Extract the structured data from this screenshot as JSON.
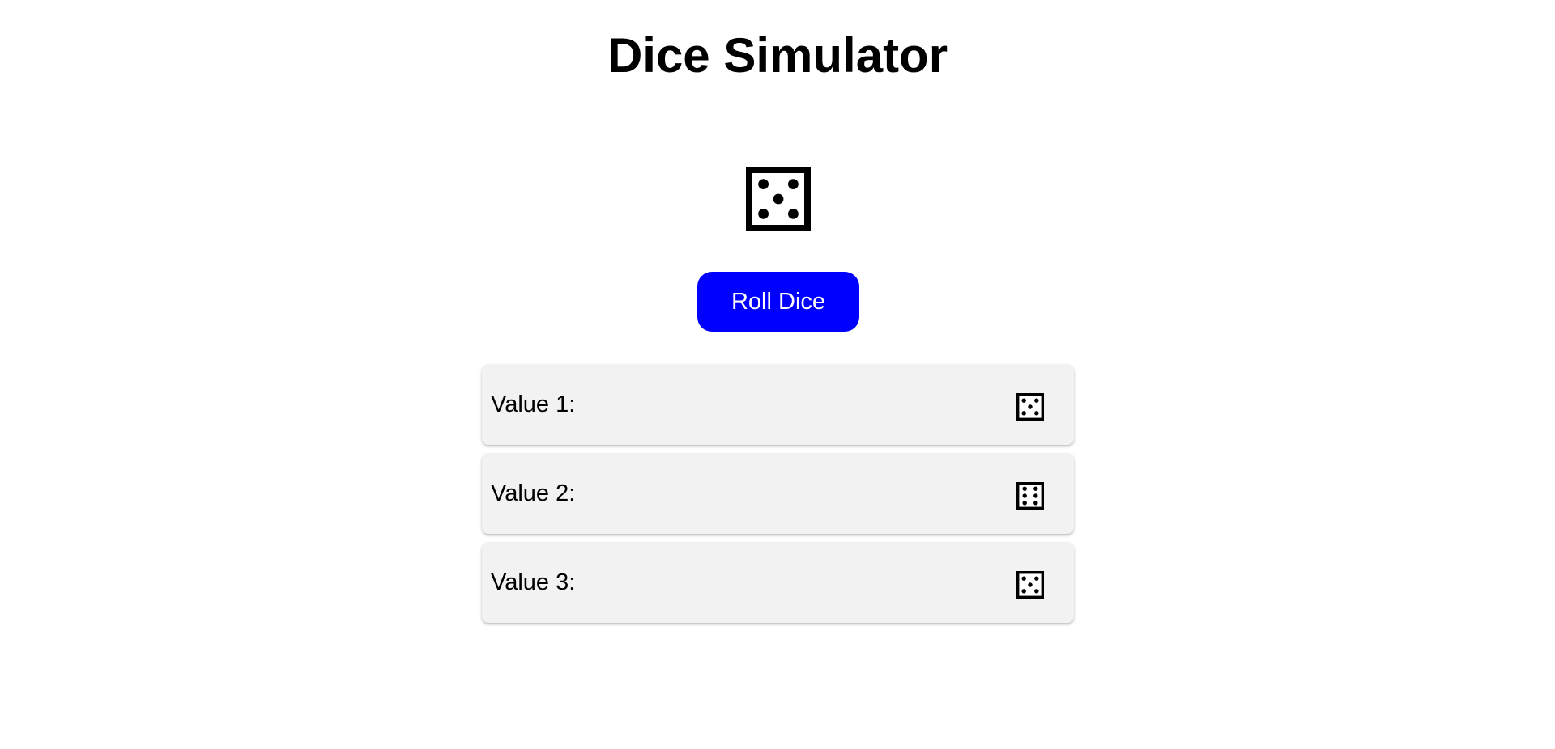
{
  "header": {
    "title": "Dice Simulator"
  },
  "main_die": {
    "icon": "die-face-5-icon",
    "value": 5
  },
  "roll_button": {
    "label": "Roll Dice",
    "color": "#0000ff"
  },
  "results": [
    {
      "label": "Value 1:",
      "icon": "die-face-5-icon",
      "value": 5
    },
    {
      "label": "Value 2:",
      "icon": "die-face-6-icon",
      "value": 6
    },
    {
      "label": "Value 3:",
      "icon": "die-face-5-icon",
      "value": 5
    }
  ]
}
